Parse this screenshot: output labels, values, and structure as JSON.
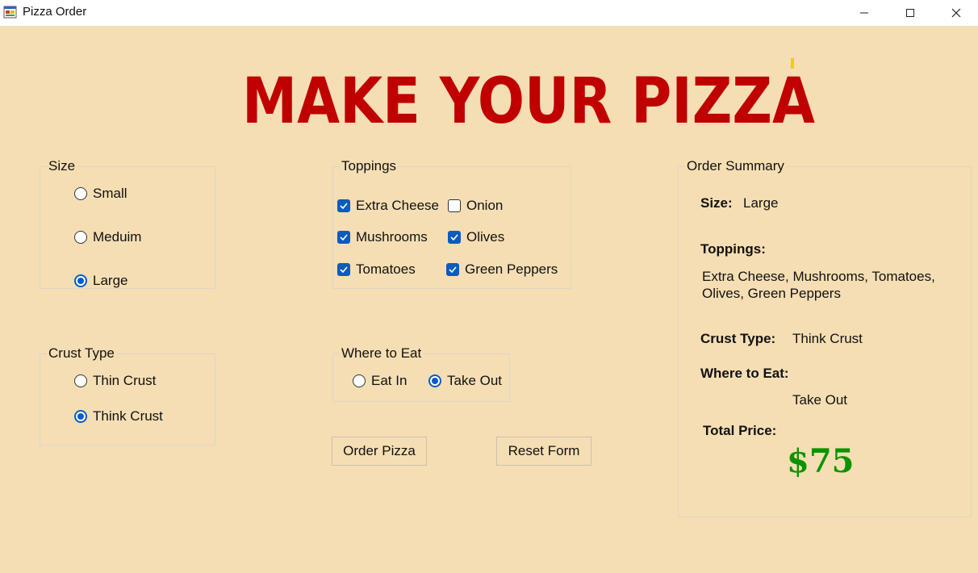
{
  "window": {
    "title": "Pizza Order"
  },
  "banner": {
    "text": "MAKE YOUR PIZZA"
  },
  "size": {
    "legend": "Size",
    "options": [
      {
        "label": "Small",
        "selected": false
      },
      {
        "label": "Meduim",
        "selected": false
      },
      {
        "label": "Large",
        "selected": true
      }
    ]
  },
  "crust": {
    "legend": "Crust Type",
    "options": [
      {
        "label": "Thin Crust",
        "selected": false
      },
      {
        "label": "Think Crust",
        "selected": true
      }
    ]
  },
  "toppings": {
    "legend": "Toppings",
    "items": [
      {
        "label": "Extra Cheese",
        "checked": true
      },
      {
        "label": "Onion",
        "checked": false
      },
      {
        "label": "Mushrooms",
        "checked": true
      },
      {
        "label": "Olives",
        "checked": true
      },
      {
        "label": "Tomatoes",
        "checked": true
      },
      {
        "label": "Green Peppers",
        "checked": true
      }
    ]
  },
  "where": {
    "legend": "Where to Eat",
    "options": [
      {
        "label": "Eat In",
        "selected": false
      },
      {
        "label": "Take Out",
        "selected": true
      }
    ]
  },
  "buttons": {
    "order": "Order Pizza",
    "reset": "Reset Form"
  },
  "summary": {
    "legend": "Order Summary",
    "size_label": "Size:",
    "size_value": "Large",
    "toppings_label": "Toppings:",
    "toppings_line1": "Extra Cheese, Mushrooms, Tomatoes,",
    "toppings_line2": "Olives, Green Peppers",
    "crust_label": "Crust Type:",
    "crust_value": "Think Crust",
    "where_label": "Where to Eat:",
    "where_value": "Take Out",
    "price_label": "Total Price:",
    "price_value": "$75"
  },
  "colors": {
    "background": "#f5deb3",
    "banner": "#c00000",
    "price": "#0a9400",
    "accent": "#0a5bc2"
  }
}
